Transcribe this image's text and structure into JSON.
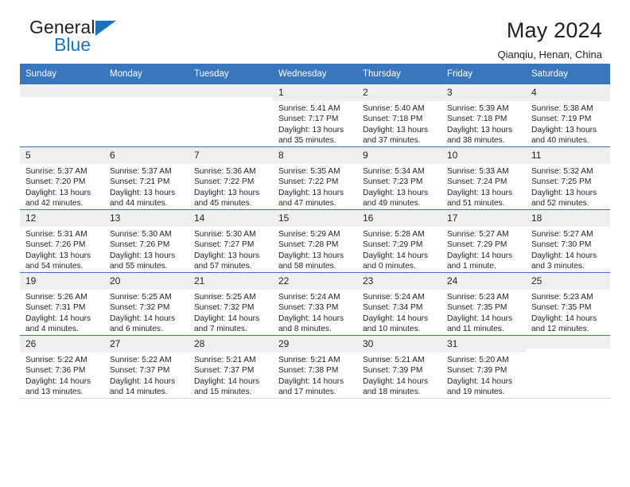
{
  "brand": {
    "word1": "General",
    "word2": "Blue",
    "triangle_color": "#1b75bc"
  },
  "header": {
    "title": "May 2024",
    "subtitle": "Qianqiu, Henan, China"
  },
  "colors": {
    "header_blue": "#3a76bd",
    "daynum_gray": "#efefef",
    "text": "#231f20"
  },
  "columns": [
    "Sunday",
    "Monday",
    "Tuesday",
    "Wednesday",
    "Thursday",
    "Friday",
    "Saturday"
  ],
  "weeks": [
    [
      {
        "day": "",
        "blank": true
      },
      {
        "day": "",
        "blank": true
      },
      {
        "day": "",
        "blank": true
      },
      {
        "day": "1",
        "sunrise": "Sunrise: 5:41 AM",
        "sunset": "Sunset: 7:17 PM",
        "daylight1": "Daylight: 13 hours",
        "daylight2": "and 35 minutes."
      },
      {
        "day": "2",
        "sunrise": "Sunrise: 5:40 AM",
        "sunset": "Sunset: 7:18 PM",
        "daylight1": "Daylight: 13 hours",
        "daylight2": "and 37 minutes."
      },
      {
        "day": "3",
        "sunrise": "Sunrise: 5:39 AM",
        "sunset": "Sunset: 7:18 PM",
        "daylight1": "Daylight: 13 hours",
        "daylight2": "and 38 minutes."
      },
      {
        "day": "4",
        "sunrise": "Sunrise: 5:38 AM",
        "sunset": "Sunset: 7:19 PM",
        "daylight1": "Daylight: 13 hours",
        "daylight2": "and 40 minutes."
      }
    ],
    [
      {
        "day": "5",
        "sunrise": "Sunrise: 5:37 AM",
        "sunset": "Sunset: 7:20 PM",
        "daylight1": "Daylight: 13 hours",
        "daylight2": "and 42 minutes."
      },
      {
        "day": "6",
        "sunrise": "Sunrise: 5:37 AM",
        "sunset": "Sunset: 7:21 PM",
        "daylight1": "Daylight: 13 hours",
        "daylight2": "and 44 minutes."
      },
      {
        "day": "7",
        "sunrise": "Sunrise: 5:36 AM",
        "sunset": "Sunset: 7:22 PM",
        "daylight1": "Daylight: 13 hours",
        "daylight2": "and 45 minutes."
      },
      {
        "day": "8",
        "sunrise": "Sunrise: 5:35 AM",
        "sunset": "Sunset: 7:22 PM",
        "daylight1": "Daylight: 13 hours",
        "daylight2": "and 47 minutes."
      },
      {
        "day": "9",
        "sunrise": "Sunrise: 5:34 AM",
        "sunset": "Sunset: 7:23 PM",
        "daylight1": "Daylight: 13 hours",
        "daylight2": "and 49 minutes."
      },
      {
        "day": "10",
        "sunrise": "Sunrise: 5:33 AM",
        "sunset": "Sunset: 7:24 PM",
        "daylight1": "Daylight: 13 hours",
        "daylight2": "and 51 minutes."
      },
      {
        "day": "11",
        "sunrise": "Sunrise: 5:32 AM",
        "sunset": "Sunset: 7:25 PM",
        "daylight1": "Daylight: 13 hours",
        "daylight2": "and 52 minutes."
      }
    ],
    [
      {
        "day": "12",
        "sunrise": "Sunrise: 5:31 AM",
        "sunset": "Sunset: 7:26 PM",
        "daylight1": "Daylight: 13 hours",
        "daylight2": "and 54 minutes."
      },
      {
        "day": "13",
        "sunrise": "Sunrise: 5:30 AM",
        "sunset": "Sunset: 7:26 PM",
        "daylight1": "Daylight: 13 hours",
        "daylight2": "and 55 minutes."
      },
      {
        "day": "14",
        "sunrise": "Sunrise: 5:30 AM",
        "sunset": "Sunset: 7:27 PM",
        "daylight1": "Daylight: 13 hours",
        "daylight2": "and 57 minutes."
      },
      {
        "day": "15",
        "sunrise": "Sunrise: 5:29 AM",
        "sunset": "Sunset: 7:28 PM",
        "daylight1": "Daylight: 13 hours",
        "daylight2": "and 58 minutes."
      },
      {
        "day": "16",
        "sunrise": "Sunrise: 5:28 AM",
        "sunset": "Sunset: 7:29 PM",
        "daylight1": "Daylight: 14 hours",
        "daylight2": "and 0 minutes."
      },
      {
        "day": "17",
        "sunrise": "Sunrise: 5:27 AM",
        "sunset": "Sunset: 7:29 PM",
        "daylight1": "Daylight: 14 hours",
        "daylight2": "and 1 minute."
      },
      {
        "day": "18",
        "sunrise": "Sunrise: 5:27 AM",
        "sunset": "Sunset: 7:30 PM",
        "daylight1": "Daylight: 14 hours",
        "daylight2": "and 3 minutes."
      }
    ],
    [
      {
        "day": "19",
        "sunrise": "Sunrise: 5:26 AM",
        "sunset": "Sunset: 7:31 PM",
        "daylight1": "Daylight: 14 hours",
        "daylight2": "and 4 minutes."
      },
      {
        "day": "20",
        "sunrise": "Sunrise: 5:25 AM",
        "sunset": "Sunset: 7:32 PM",
        "daylight1": "Daylight: 14 hours",
        "daylight2": "and 6 minutes."
      },
      {
        "day": "21",
        "sunrise": "Sunrise: 5:25 AM",
        "sunset": "Sunset: 7:32 PM",
        "daylight1": "Daylight: 14 hours",
        "daylight2": "and 7 minutes."
      },
      {
        "day": "22",
        "sunrise": "Sunrise: 5:24 AM",
        "sunset": "Sunset: 7:33 PM",
        "daylight1": "Daylight: 14 hours",
        "daylight2": "and 8 minutes."
      },
      {
        "day": "23",
        "sunrise": "Sunrise: 5:24 AM",
        "sunset": "Sunset: 7:34 PM",
        "daylight1": "Daylight: 14 hours",
        "daylight2": "and 10 minutes."
      },
      {
        "day": "24",
        "sunrise": "Sunrise: 5:23 AM",
        "sunset": "Sunset: 7:35 PM",
        "daylight1": "Daylight: 14 hours",
        "daylight2": "and 11 minutes."
      },
      {
        "day": "25",
        "sunrise": "Sunrise: 5:23 AM",
        "sunset": "Sunset: 7:35 PM",
        "daylight1": "Daylight: 14 hours",
        "daylight2": "and 12 minutes."
      }
    ],
    [
      {
        "day": "26",
        "sunrise": "Sunrise: 5:22 AM",
        "sunset": "Sunset: 7:36 PM",
        "daylight1": "Daylight: 14 hours",
        "daylight2": "and 13 minutes."
      },
      {
        "day": "27",
        "sunrise": "Sunrise: 5:22 AM",
        "sunset": "Sunset: 7:37 PM",
        "daylight1": "Daylight: 14 hours",
        "daylight2": "and 14 minutes."
      },
      {
        "day": "28",
        "sunrise": "Sunrise: 5:21 AM",
        "sunset": "Sunset: 7:37 PM",
        "daylight1": "Daylight: 14 hours",
        "daylight2": "and 15 minutes."
      },
      {
        "day": "29",
        "sunrise": "Sunrise: 5:21 AM",
        "sunset": "Sunset: 7:38 PM",
        "daylight1": "Daylight: 14 hours",
        "daylight2": "and 17 minutes."
      },
      {
        "day": "30",
        "sunrise": "Sunrise: 5:21 AM",
        "sunset": "Sunset: 7:39 PM",
        "daylight1": "Daylight: 14 hours",
        "daylight2": "and 18 minutes."
      },
      {
        "day": "31",
        "sunrise": "Sunrise: 5:20 AM",
        "sunset": "Sunset: 7:39 PM",
        "daylight1": "Daylight: 14 hours",
        "daylight2": "and 19 minutes."
      },
      {
        "day": "",
        "blank": true
      }
    ]
  ]
}
